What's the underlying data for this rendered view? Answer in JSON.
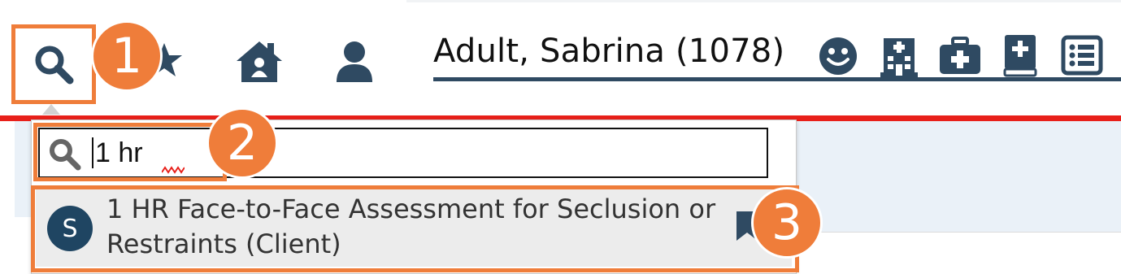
{
  "toolbar": {
    "search_icon": "search-icon",
    "favorites_icon": "star-icon",
    "home_icon": "home-icon",
    "user_icon": "user-icon"
  },
  "patient": {
    "name": "Adult, Sabrina (1078)",
    "icons": [
      "smiley-icon",
      "hospital-icon",
      "medkit-icon",
      "medical-book-icon",
      "list-icon"
    ]
  },
  "search": {
    "value": "1 hr",
    "placeholder": ""
  },
  "results": [
    {
      "badge": "S",
      "title": "1 HR Face-to-Face Assessment for Seclusion or Restraints (Client)",
      "action_icon": "bookmark-icon"
    }
  ],
  "callouts": [
    "1",
    "2",
    "3"
  ],
  "colors": {
    "accent": "#ef7d3a",
    "navy": "#2f4a62",
    "alert_red": "#e8201a",
    "badge": "#1f4562"
  }
}
